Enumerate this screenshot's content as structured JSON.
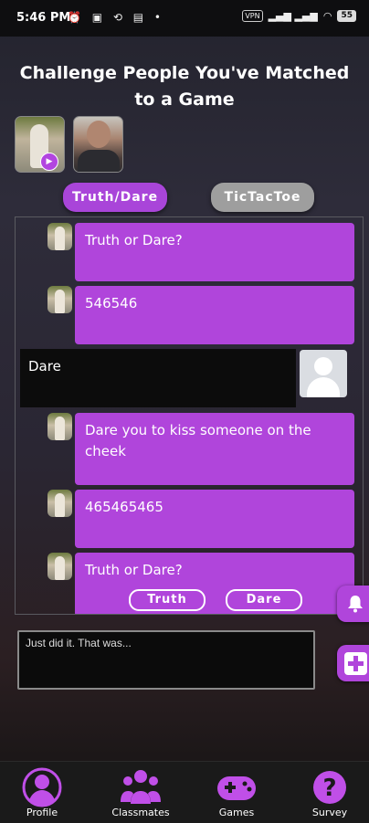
{
  "status_bar": {
    "time": "5:46 PM",
    "left_icons": "⏰ ▣ ⟲ ▤ •",
    "vpn": "VPN",
    "signal": "▂▄▆ ▂▄▆",
    "wifi": "◠",
    "battery": "55"
  },
  "header": {
    "title": "Challenge People You've Matched to a Game"
  },
  "tabs": [
    {
      "label": "Truth/Dare",
      "active": true
    },
    {
      "label": "TicTacToe",
      "active": false
    }
  ],
  "messages": [
    {
      "text": "Truth or Dare?"
    },
    {
      "text": "546546"
    },
    {
      "text": "Dare you to kiss someone on the cheek"
    },
    {
      "text": "465465465"
    },
    {
      "text": "Truth or Dare?"
    }
  ],
  "reply": {
    "text": "Dare"
  },
  "choice_buttons": {
    "truth": "Truth",
    "dare": "Dare"
  },
  "input": {
    "placeholder": "Just did it. That was..."
  },
  "nav": [
    {
      "label": "Profile",
      "icon": "profile-icon"
    },
    {
      "label": "Classmates",
      "icon": "classmates-icon"
    },
    {
      "label": "Games",
      "icon": "gamepad-icon"
    },
    {
      "label": "Survey",
      "icon": "help-icon"
    }
  ],
  "colors": {
    "accent": "#b045db",
    "inactive_tab": "#9e9e9e"
  }
}
